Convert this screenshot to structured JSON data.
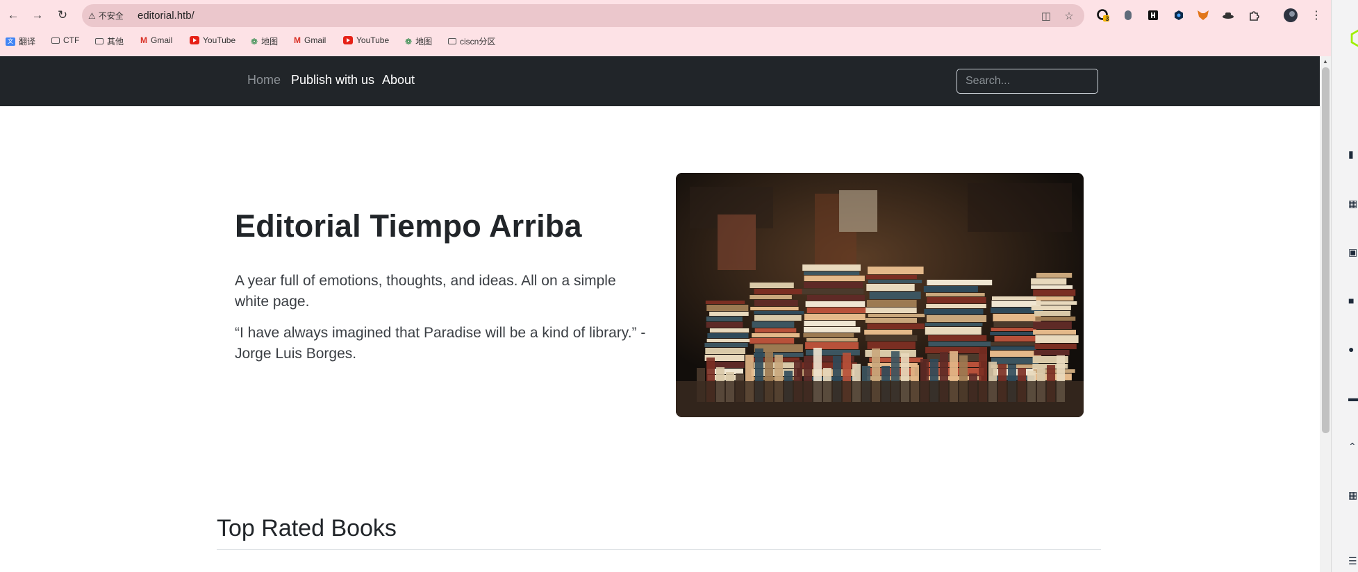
{
  "browser": {
    "security_label": "不安全",
    "url": "editorial.htb/",
    "extension_badge": "3",
    "bookmarks": [
      "翻译",
      "CTF",
      "其他",
      "Gmail",
      "YouTube",
      "地图",
      "Gmail",
      "YouTube",
      "地图",
      "ciscn分区"
    ]
  },
  "nav": {
    "links": [
      "Home",
      "Publish with us",
      "About"
    ],
    "search_placeholder": "Search..."
  },
  "hero": {
    "title": "Editorial Tiempo Arriba",
    "tagline": "A year full of emotions, thoughts, and ideas. All on a simple white page.",
    "quote": "“I have always imagined that Paradise will be a kind of library.” - Jorge Luis Borges."
  },
  "section": {
    "title": "Top Rated Books"
  },
  "colors": {
    "chrome_bg": "#fde2e6",
    "navbar_bg": "#212529",
    "accent_green": "#9fef00"
  }
}
